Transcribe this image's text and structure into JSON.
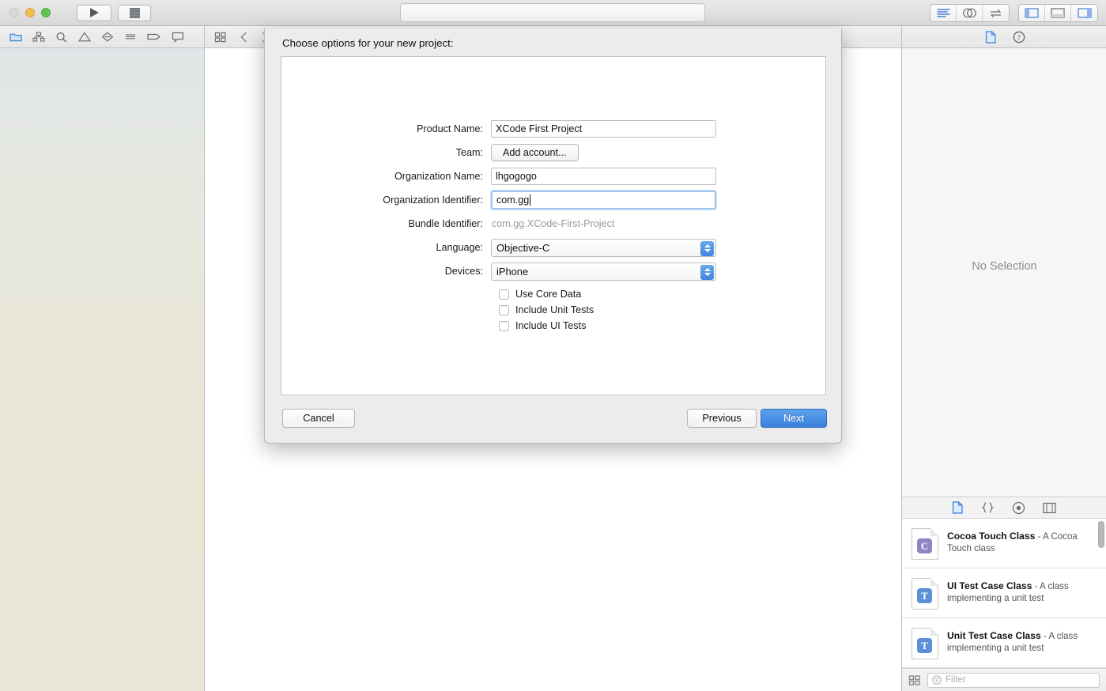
{
  "window": {
    "traffic_lights": [
      "close",
      "minimize",
      "maximize"
    ],
    "run_button": "run-icon",
    "stop_button": "stop-icon",
    "activity_status": ""
  },
  "toolbar_right": {
    "editor_modes": [
      "standard-editor-icon",
      "assistant-editor-icon",
      "version-editor-icon"
    ],
    "panel_toggles": [
      "navigator-toggle-icon",
      "debug-toggle-icon",
      "utilities-toggle-icon"
    ]
  },
  "navigator_bar": {
    "icons": [
      "folder-icon",
      "source-control-icon",
      "search-icon",
      "warning-icon",
      "test-icon",
      "debug-icon",
      "breakpoint-icon",
      "report-icon"
    ],
    "extra": [
      "grid-icon",
      "back-chevron-icon",
      "forward-chevron-icon"
    ]
  },
  "inspector_bar": {
    "icons": [
      "file-inspector-icon",
      "quick-help-icon"
    ]
  },
  "editor": {
    "no_selection": "No Selection"
  },
  "library": {
    "tabs": [
      "file-template-icon",
      "code-snippet-icon",
      "media-icon",
      "color-palette-icon"
    ],
    "items": [
      {
        "title": "Cocoa Touch Class",
        "desc": "- A Cocoa Touch class",
        "badge": "C",
        "badge_color": "#8e86c4"
      },
      {
        "title": "UI Test Case Class",
        "desc": "- A class implementing a unit test",
        "badge": "T",
        "badge_color": "#5c8fd6"
      },
      {
        "title": "Unit Test Case Class",
        "desc": "- A class implementing a unit test",
        "badge": "T",
        "badge_color": "#5c8fd6"
      }
    ],
    "filter_placeholder": "Filter",
    "view_toggle": "grid-view-icon"
  },
  "dialog": {
    "title": "Choose options for your new project:",
    "fields": {
      "product_name_label": "Product Name:",
      "product_name_value": "XCode First Project",
      "team_label": "Team:",
      "team_button": "Add account...",
      "organization_name_label": "Organization Name:",
      "organization_name_value": "lhgogogo",
      "organization_identifier_label": "Organization Identifier:",
      "organization_identifier_value": "com.gg",
      "bundle_identifier_label": "Bundle Identifier:",
      "bundle_identifier_value": "com.gg.XCode-First-Project",
      "language_label": "Language:",
      "language_value": "Objective-C",
      "devices_label": "Devices:",
      "devices_value": "iPhone"
    },
    "checkboxes": [
      {
        "label": "Use Core Data",
        "checked": false
      },
      {
        "label": "Include Unit Tests",
        "checked": false
      },
      {
        "label": "Include UI Tests",
        "checked": false
      }
    ],
    "buttons": {
      "cancel": "Cancel",
      "previous": "Previous",
      "next": "Next"
    },
    "accent_color": "#3b7fdd",
    "focus_ring_color": "#9dc6ef"
  }
}
